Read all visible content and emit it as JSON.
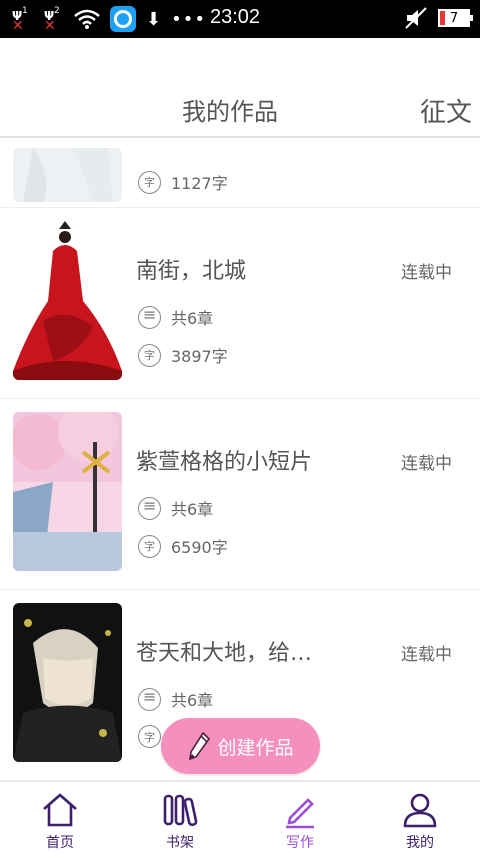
{
  "status_bar": {
    "sim1": "1",
    "sim2": "2",
    "time": "23:02",
    "battery": "7",
    "more": "•••"
  },
  "header": {
    "tab_works": "我的作品",
    "tab_contest": "征文"
  },
  "works": [
    {
      "title": "",
      "state": "",
      "chapters": "",
      "words": "1127字"
    },
    {
      "title": "南街，北城",
      "state": "连载中",
      "chapters": "共6章",
      "words": "3897字"
    },
    {
      "title": "紫萱格格的小短片",
      "state": "连载中",
      "chapters": "共6章",
      "words": "6590字"
    },
    {
      "title": "苍天和大地，给…",
      "state": "连载中",
      "chapters": "共6章",
      "words": ""
    }
  ],
  "icons": {
    "word_glyph": "字"
  },
  "fab": {
    "label": "创建作品"
  },
  "nav": [
    {
      "label": "首页",
      "icon": "home-icon"
    },
    {
      "label": "书架",
      "icon": "bookshelf-icon"
    },
    {
      "label": "写作",
      "icon": "write-icon"
    },
    {
      "label": "我的",
      "icon": "profile-icon"
    }
  ],
  "colors": {
    "accent": "#9c4fd9",
    "nav_dark": "#3d1f6b",
    "fab": "#f58fbd"
  }
}
